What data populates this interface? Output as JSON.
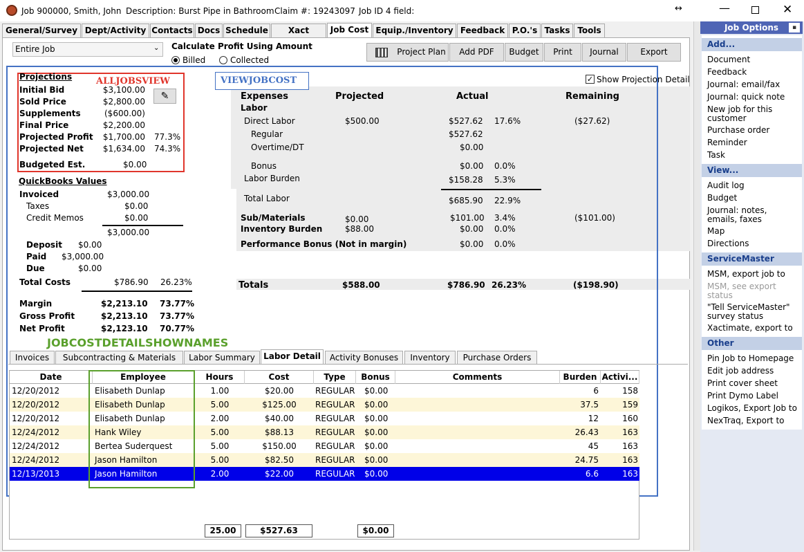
{
  "window": {
    "title": "Job 900000, Smith, John",
    "description": "Description: Burst Pipe in Bathroom",
    "claim": "Claim #: 19243097",
    "jobid": "Job ID 4 field:"
  },
  "tabs": [
    "General/Survey",
    "Dept/Activity",
    "Contacts",
    "Docs",
    "Schedule",
    "Xact Status",
    "Job Cost",
    "Equip./Inventory",
    "Feedback",
    "P.O.'s",
    "Tasks",
    "Tools"
  ],
  "filter": {
    "selected": "Entire Job",
    "calc_label": "Calculate Profit Using Amount",
    "opt1": "Billed",
    "opt2": "Collected"
  },
  "toolbar": {
    "project_plan": "Project Plan",
    "add_pdf": "Add PDF",
    "budget": "Budget",
    "print": "Print",
    "journal": "Journal",
    "export": "Export"
  },
  "annotations": {
    "alljobs": "ALLJOBSVIEW",
    "viewjobcost": "VIEWJOBCOST",
    "detail": "JOBCOSTDETAILSHOWNAMES"
  },
  "show_detail": "Show Projection Detail",
  "projections": {
    "title": "Projections",
    "rows": [
      {
        "label": "Initial Bid",
        "value": "$3,100.00",
        "pct": ""
      },
      {
        "label": "Sold Price",
        "value": "$2,800.00",
        "pct": ""
      },
      {
        "label": "Supplements",
        "value": "($600.00)",
        "pct": ""
      },
      {
        "label": "Final Price",
        "value": "$2,200.00",
        "pct": ""
      },
      {
        "label": "Projected Profit",
        "value": "$1,700.00",
        "pct": "77.3%"
      },
      {
        "label": "Projected Net",
        "value": "$1,634.00",
        "pct": "74.3%"
      }
    ],
    "budgeted_label": "Budgeted Est.",
    "budgeted_value": "$0.00"
  },
  "qb": {
    "title": "QuickBooks Values",
    "invoiced_label": "Invoiced",
    "invoiced": "$3,000.00",
    "taxes_label": "Taxes",
    "taxes": "$0.00",
    "credit_label": "Credit Memos",
    "credit": "$0.00",
    "subtotal": "$3,000.00",
    "deposit_label": "Deposit",
    "deposit": "$0.00",
    "paid_label": "Paid",
    "paid": "$3,000.00",
    "due_label": "Due",
    "due": "$0.00",
    "totalcosts_label": "Total Costs",
    "totalcosts": "$786.90",
    "totalcosts_pct": "26.23%"
  },
  "summary": [
    {
      "label": "Margin",
      "value": "$2,213.10",
      "pct": "73.77%"
    },
    {
      "label": "Gross Profit",
      "value": "$2,213.10",
      "pct": "73.77%"
    },
    {
      "label": "Net Profit",
      "value": "$2,123.10",
      "pct": "70.77%"
    }
  ],
  "costs": {
    "h_expenses": "Expenses",
    "h_projected": "Projected",
    "h_actual": "Actual",
    "h_remaining": "Remaining",
    "labor": "Labor",
    "direct_label": "Direct Labor",
    "direct_proj": "$500.00",
    "direct_act": "$527.62",
    "direct_pct": "17.6%",
    "direct_rem": "($27.62)",
    "regular_label": "Regular",
    "regular_act": "$527.62",
    "overtime_label": "Overtime/DT",
    "overtime_act": "$0.00",
    "bonus_label": "Bonus",
    "bonus_act": "$0.00",
    "bonus_pct": "0.0%",
    "burden_label": "Labor Burden",
    "burden_act": "$158.28",
    "burden_pct": "5.3%",
    "totallabor_label": "Total Labor",
    "totallabor_act": "$685.90",
    "totallabor_pct": "22.9%",
    "sub_label": "Sub/Materials",
    "sub_proj": "$0.00",
    "sub_act": "$101.00",
    "sub_pct": "3.4%",
    "sub_rem": "($101.00)",
    "inv_label": "Inventory Burden",
    "inv_proj": "$88.00",
    "inv_act": "$0.00",
    "inv_pct": "0.0%",
    "perf_label": "Performance Bonus (Not in margin)",
    "perf_act": "$0.00",
    "perf_pct": "0.0%",
    "totals_label": "Totals",
    "totals_proj": "$588.00",
    "totals_act": "$786.90",
    "totals_pct": "26.23%",
    "totals_rem": "($198.90)"
  },
  "lower_tabs": [
    "Invoices",
    "Subcontracting & Materials",
    "Labor Summary",
    "Labor Detail",
    "Activity Bonuses",
    "Inventory",
    "Purchase Orders"
  ],
  "grid": {
    "headers": [
      "Date",
      "Employee",
      "Hours",
      "Cost",
      "Type",
      "Bonus",
      "Comments",
      "Burden",
      "Activi..."
    ],
    "rows": [
      [
        "12/20/2012",
        "Elisabeth Dunlap",
        "1.00",
        "$20.00",
        "REGULAR",
        "$0.00",
        "",
        "6",
        "158"
      ],
      [
        "12/20/2012",
        "Elisabeth Dunlap",
        "5.00",
        "$125.00",
        "REGULAR",
        "$0.00",
        "",
        "37.5",
        "159"
      ],
      [
        "12/20/2012",
        "Elisabeth Dunlap",
        "2.00",
        "$40.00",
        "REGULAR",
        "$0.00",
        "",
        "12",
        "160"
      ],
      [
        "12/24/2012",
        "Hank Wiley",
        "5.00",
        "$88.13",
        "REGULAR",
        "$0.00",
        "",
        "26.43",
        "163"
      ],
      [
        "12/24/2012",
        "Bertea Suderquest",
        "5.00",
        "$150.00",
        "REGULAR",
        "$0.00",
        "",
        "45",
        "163"
      ],
      [
        "12/24/2012",
        "Jason Hamilton",
        "5.00",
        "$82.50",
        "REGULAR",
        "$0.00",
        "",
        "24.75",
        "163"
      ],
      [
        "12/13/2013",
        "Jason Hamilton",
        "2.00",
        "$22.00",
        "REGULAR",
        "$0.00",
        "",
        "6.6",
        "163"
      ]
    ],
    "total_hours": "25.00",
    "total_cost": "$527.63",
    "total_bonus": "$0.00"
  },
  "sidebar": {
    "title": "Job Options",
    "sections": [
      {
        "header": "Add...",
        "items": [
          "Document",
          "Feedback",
          "Journal: email/fax",
          "Journal: quick note",
          "New job for this customer",
          "Purchase order",
          "Reminder",
          "Task"
        ]
      },
      {
        "header": "View...",
        "items": [
          "Audit log",
          "Budget",
          "Journal: notes, emails, faxes",
          "Map",
          "Directions"
        ]
      },
      {
        "header": "ServiceMaster",
        "items": [
          "MSM, export job to",
          "MSM, see export status",
          "\"Tell ServiceMaster\" survey status",
          "Xactimate, export to"
        ]
      },
      {
        "header": "Other",
        "items": [
          "Pin Job to Homepage",
          "Edit job address",
          "Print cover sheet",
          "Print Dymo Label",
          "Logikos, Export Job to",
          "NexTraq, Export to"
        ]
      }
    ]
  },
  "colors": {
    "accent": "#0000e8",
    "sidebar_header": "#c3d0e6",
    "row_alt": "#fdf6d8",
    "red_box": "#e0352b",
    "blue_box": "#4472c4",
    "green_box": "#5aa02c"
  }
}
